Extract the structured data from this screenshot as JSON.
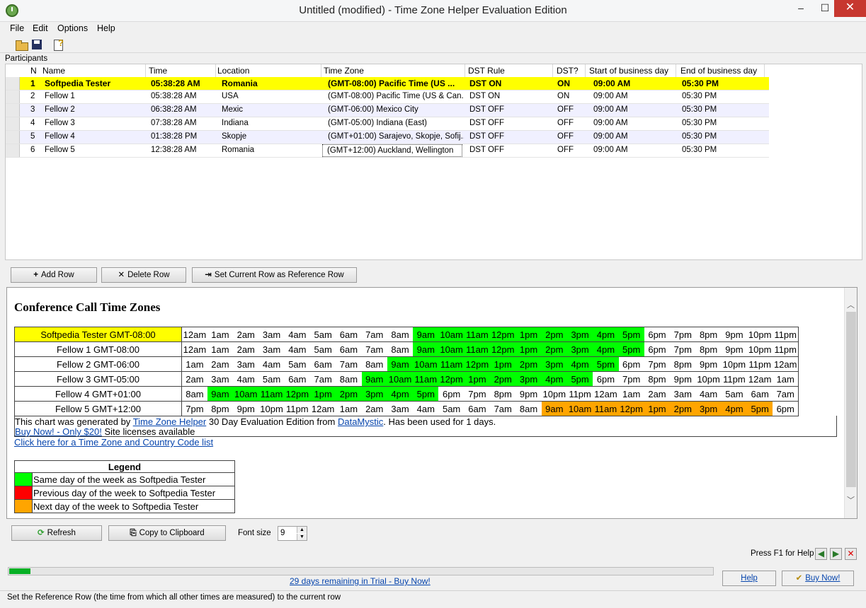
{
  "window": {
    "title": "Untitled (modified) - Time Zone Helper Evaluation Edition",
    "min": "–",
    "max": "☐",
    "close": "✕"
  },
  "menu": [
    "File",
    "Edit",
    "Options",
    "Help"
  ],
  "participants_label": "Participants",
  "grid": {
    "columns": [
      "N",
      "Name",
      "Time",
      "Location",
      "Time Zone",
      "DST Rule",
      "DST?",
      "Start of business day",
      "End of business day"
    ],
    "rows": [
      {
        "n": "1",
        "name": "Softpedia Tester",
        "time": "05:38:28 AM",
        "location": "Romania",
        "tz": "(GMT-08:00) Pacific Time (US ...",
        "dst_rule": "DST ON",
        "dst": "ON",
        "start": "09:00 AM",
        "end": "05:30 PM"
      },
      {
        "n": "2",
        "name": "Fellow 1",
        "time": "05:38:28 AM",
        "location": "USA",
        "tz": "(GMT-08:00) Pacific Time (US & Can...",
        "dst_rule": "DST ON",
        "dst": "ON",
        "start": "09:00 AM",
        "end": "05:30 PM"
      },
      {
        "n": "3",
        "name": "Fellow 2",
        "time": "06:38:28 AM",
        "location": "Mexic",
        "tz": "(GMT-06:00) Mexico City",
        "dst_rule": "DST OFF",
        "dst": "OFF",
        "start": "09:00 AM",
        "end": "05:30 PM"
      },
      {
        "n": "4",
        "name": "Fellow 3",
        "time": "07:38:28 AM",
        "location": "Indiana",
        "tz": "(GMT-05:00) Indiana (East)",
        "dst_rule": "DST OFF",
        "dst": "OFF",
        "start": "09:00 AM",
        "end": "05:30 PM"
      },
      {
        "n": "5",
        "name": "Fellow 4",
        "time": "01:38:28 PM",
        "location": "Skopje",
        "tz": "(GMT+01:00) Sarajevo, Skopje, Sofij...",
        "dst_rule": "DST OFF",
        "dst": "OFF",
        "start": "09:00 AM",
        "end": "05:30 PM"
      },
      {
        "n": "6",
        "name": "Fellow 5",
        "time": "12:38:28 AM",
        "location": "Romania",
        "tz": "(GMT+12:00) Auckland, Wellington",
        "dst_rule": "DST OFF",
        "dst": "OFF",
        "start": "09:00 AM",
        "end": "05:30 PM"
      }
    ]
  },
  "buttons": {
    "add_row": "Add Row",
    "delete_row": "Delete Row",
    "set_reference": "Set Current Row as Reference Row",
    "refresh": "Refresh",
    "copy_clipboard": "Copy to Clipboard"
  },
  "report": {
    "title": "Conference Call Time Zones",
    "rows": [
      {
        "label": "Softpedia Tester GMT-08:00",
        "highlight": "yellow",
        "hours": [
          "12am",
          "1am",
          "2am",
          "3am",
          "4am",
          "5am",
          "6am",
          "7am",
          "8am",
          "9am",
          "10am",
          "11am",
          "12pm",
          "1pm",
          "2pm",
          "3pm",
          "4pm",
          "5pm",
          "6pm",
          "7pm",
          "8pm",
          "9pm",
          "10pm",
          "11pm"
        ],
        "colors": [
          "",
          "",
          "",
          "",
          "",
          "",
          "",
          "",
          "",
          "g",
          "g",
          "g",
          "g",
          "g",
          "g",
          "g",
          "g",
          "g",
          "",
          "",
          "",
          "",
          "",
          ""
        ]
      },
      {
        "label": "Fellow 1 GMT-08:00",
        "highlight": "",
        "hours": [
          "12am",
          "1am",
          "2am",
          "3am",
          "4am",
          "5am",
          "6am",
          "7am",
          "8am",
          "9am",
          "10am",
          "11am",
          "12pm",
          "1pm",
          "2pm",
          "3pm",
          "4pm",
          "5pm",
          "6pm",
          "7pm",
          "8pm",
          "9pm",
          "10pm",
          "11pm"
        ],
        "colors": [
          "",
          "",
          "",
          "",
          "",
          "",
          "",
          "",
          "",
          "g",
          "g",
          "g",
          "g",
          "g",
          "g",
          "g",
          "g",
          "g",
          "",
          "",
          "",
          "",
          "",
          ""
        ]
      },
      {
        "label": "Fellow 2 GMT-06:00",
        "highlight": "",
        "hours": [
          "1am",
          "2am",
          "3am",
          "4am",
          "5am",
          "6am",
          "7am",
          "8am",
          "9am",
          "10am",
          "11am",
          "12pm",
          "1pm",
          "2pm",
          "3pm",
          "4pm",
          "5pm",
          "6pm",
          "7pm",
          "8pm",
          "9pm",
          "10pm",
          "11pm",
          "12am"
        ],
        "colors": [
          "",
          "",
          "",
          "",
          "",
          "",
          "",
          "",
          "g",
          "g",
          "g",
          "g",
          "g",
          "g",
          "g",
          "g",
          "g",
          "",
          "",
          "",
          "",
          "",
          "",
          ""
        ]
      },
      {
        "label": "Fellow 3 GMT-05:00",
        "highlight": "",
        "hours": [
          "2am",
          "3am",
          "4am",
          "5am",
          "6am",
          "7am",
          "8am",
          "9am",
          "10am",
          "11am",
          "12pm",
          "1pm",
          "2pm",
          "3pm",
          "4pm",
          "5pm",
          "6pm",
          "7pm",
          "8pm",
          "9pm",
          "10pm",
          "11pm",
          "12am",
          "1am"
        ],
        "colors": [
          "",
          "",
          "",
          "",
          "",
          "",
          "",
          "g",
          "g",
          "g",
          "g",
          "g",
          "g",
          "g",
          "g",
          "g",
          "",
          "",
          "",
          "",
          "",
          "",
          "",
          ""
        ]
      },
      {
        "label": "Fellow 4 GMT+01:00",
        "highlight": "",
        "hours": [
          "8am",
          "9am",
          "10am",
          "11am",
          "12pm",
          "1pm",
          "2pm",
          "3pm",
          "4pm",
          "5pm",
          "6pm",
          "7pm",
          "8pm",
          "9pm",
          "10pm",
          "11pm",
          "12am",
          "1am",
          "2am",
          "3am",
          "4am",
          "5am",
          "6am",
          "7am"
        ],
        "colors": [
          "",
          "g",
          "g",
          "g",
          "g",
          "g",
          "g",
          "g",
          "g",
          "g",
          "",
          "",
          "",
          "",
          "",
          "",
          "",
          "",
          "",
          "",
          "",
          "",
          "",
          ""
        ]
      },
      {
        "label": "Fellow 5 GMT+12:00",
        "highlight": "",
        "hours": [
          "7pm",
          "8pm",
          "9pm",
          "10pm",
          "11pm",
          "12am",
          "1am",
          "2am",
          "3am",
          "4am",
          "5am",
          "6am",
          "7am",
          "8am",
          "9am",
          "10am",
          "11am",
          "12pm",
          "1pm",
          "2pm",
          "3pm",
          "4pm",
          "5pm",
          "6pm"
        ],
        "colors": [
          "",
          "",
          "",
          "",
          "",
          "",
          "",
          "",
          "",
          "",
          "",
          "",
          "",
          "",
          "o",
          "o",
          "o",
          "o",
          "o",
          "o",
          "o",
          "o",
          "o",
          ""
        ]
      }
    ],
    "footer": {
      "generated_prefix": "This chart was generated by ",
      "generated_link": "Time Zone Helper",
      "generated_mid": " 30 Day Evaluation Edition from ",
      "vendor_link": "DataMystic",
      "generated_suffix": ". Has been used for 1 days.",
      "buy_link": "Buy Now! - Only $20!",
      "buy_suffix": " Site licenses available"
    },
    "code_list_link": "Click here for a Time Zone and Country Code list",
    "legend": {
      "title": "Legend",
      "items": [
        {
          "color": "#00ff00",
          "text": "Same day of the week as Softpedia Tester"
        },
        {
          "color": "#ff0000",
          "text": "Previous day of the week to Softpedia Tester"
        },
        {
          "color": "#ffa500",
          "text": "Next day of the week to Softpedia Tester"
        }
      ]
    }
  },
  "font_size": {
    "label": "Font size",
    "value": "9"
  },
  "help_hint": "Press F1 for Help a",
  "trial": {
    "progress": 0.03,
    "link": "29 days remaining in Trial - Buy Now!"
  },
  "bottom_buttons": {
    "help": "Help",
    "buy_now": "Buy Now!"
  },
  "status": "Set the Reference Row (the time from which all other times are measured) to the current row"
}
